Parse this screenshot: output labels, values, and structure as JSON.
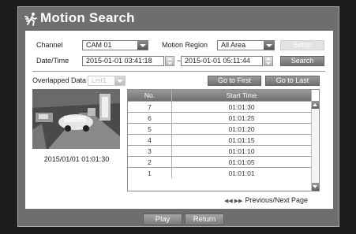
{
  "title": "Motion Search",
  "channel": {
    "label": "Channel",
    "value": "CAM 01"
  },
  "motion_region": {
    "label": "Motion Region",
    "value": "All Area"
  },
  "setup_label": "Setup",
  "datetime": {
    "label": "Date/Time",
    "start": "2015-01-01  03:41:18",
    "end": "2015-01-01  05:11:44"
  },
  "search_label": "Search",
  "overlapped": {
    "label": "Overlapped Data",
    "value": "List1"
  },
  "go_first_label": "Go to First",
  "go_last_label": "Go to Last",
  "thumbnail_caption": "2015/01/01  01:01:30",
  "table": {
    "headers": [
      "No.",
      "Start Time"
    ],
    "rows": [
      {
        "no": "7",
        "time": "01:01:30"
      },
      {
        "no": "6",
        "time": "01:01:25"
      },
      {
        "no": "5",
        "time": "01:01:20"
      },
      {
        "no": "4",
        "time": "01:01:15"
      },
      {
        "no": "3",
        "time": "01:01:10"
      },
      {
        "no": "2",
        "time": "01:01:05"
      },
      {
        "no": "1",
        "time": "01:01:01"
      }
    ]
  },
  "pager_label": "Previous/Next Page",
  "play_label": "Play",
  "return_label": "Return",
  "icons": {
    "title": "motion-walker-icon",
    "pager": "double-arrow-icon",
    "scroll_up": "triangle-up-icon",
    "scroll_down": "triangle-down-icon",
    "dropdown": "chevron-down-icon"
  }
}
